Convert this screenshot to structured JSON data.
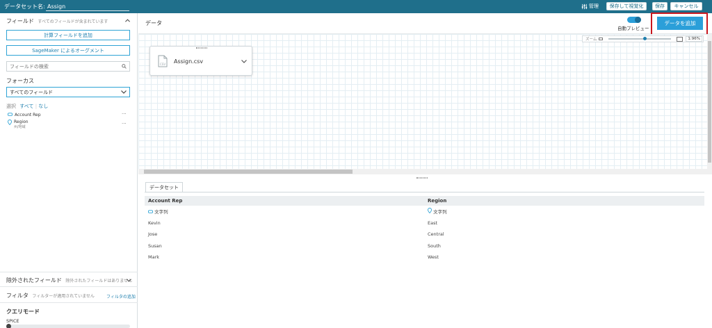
{
  "topbar": {
    "dataset_label": "データセット名:",
    "dataset_name": "Assign",
    "manage_label": "管理",
    "save_visualize_label": "保存して視覚化",
    "save_label": "保存",
    "cancel_label": "キャンセル"
  },
  "left": {
    "fields_title": "フィールド",
    "fields_subtitle": "すべてのフィールドが含まれています",
    "add_calc_field_label": "計算フィールドを追加",
    "sagemaker_label": "SageMaker によるオーグメント",
    "search_placeholder": "フィールドの検索",
    "focus_title": "フォーカス",
    "focus_selected": "すべてのフィールド",
    "select_label": "選択",
    "select_all": "すべて",
    "select_none": "なし",
    "fields": [
      {
        "name": "Account Rep",
        "type": ""
      },
      {
        "name": "Region",
        "type": "州/地域"
      }
    ],
    "excluded_title": "除外されたフィールド",
    "excluded_subtitle": "除外されたフィールドはありません",
    "filter_title": "フィルタ",
    "filter_subtitle": "フィルターが適用されていません",
    "filter_add_label": "フィルタの追加",
    "query_mode_title": "クエリモード",
    "query_mode_value": "SPICE"
  },
  "data_area": {
    "title": "データ",
    "auto_preview_label": "自動プレビュー",
    "add_data_label": "データを追加",
    "zoom_label": "ズーム",
    "zoom_fit_label": "1:96%",
    "card_label": "Assign.csv",
    "card_file_type": "CSV"
  },
  "dataset_tab": {
    "label": "データセット",
    "columns": [
      {
        "name": "Account Rep",
        "type_label": "文字列"
      },
      {
        "name": "Region",
        "type_label": "文字列"
      }
    ],
    "rows": [
      [
        "Kevin",
        "East"
      ],
      [
        "Jose",
        "Central"
      ],
      [
        "Susan",
        "South"
      ],
      [
        "Mark",
        "West"
      ]
    ]
  },
  "colors": {
    "topbar": "#1f6f8b",
    "accent": "#2ea3d5",
    "add_data_button": "#2b9fd9",
    "highlight_box": "#c8161d"
  }
}
